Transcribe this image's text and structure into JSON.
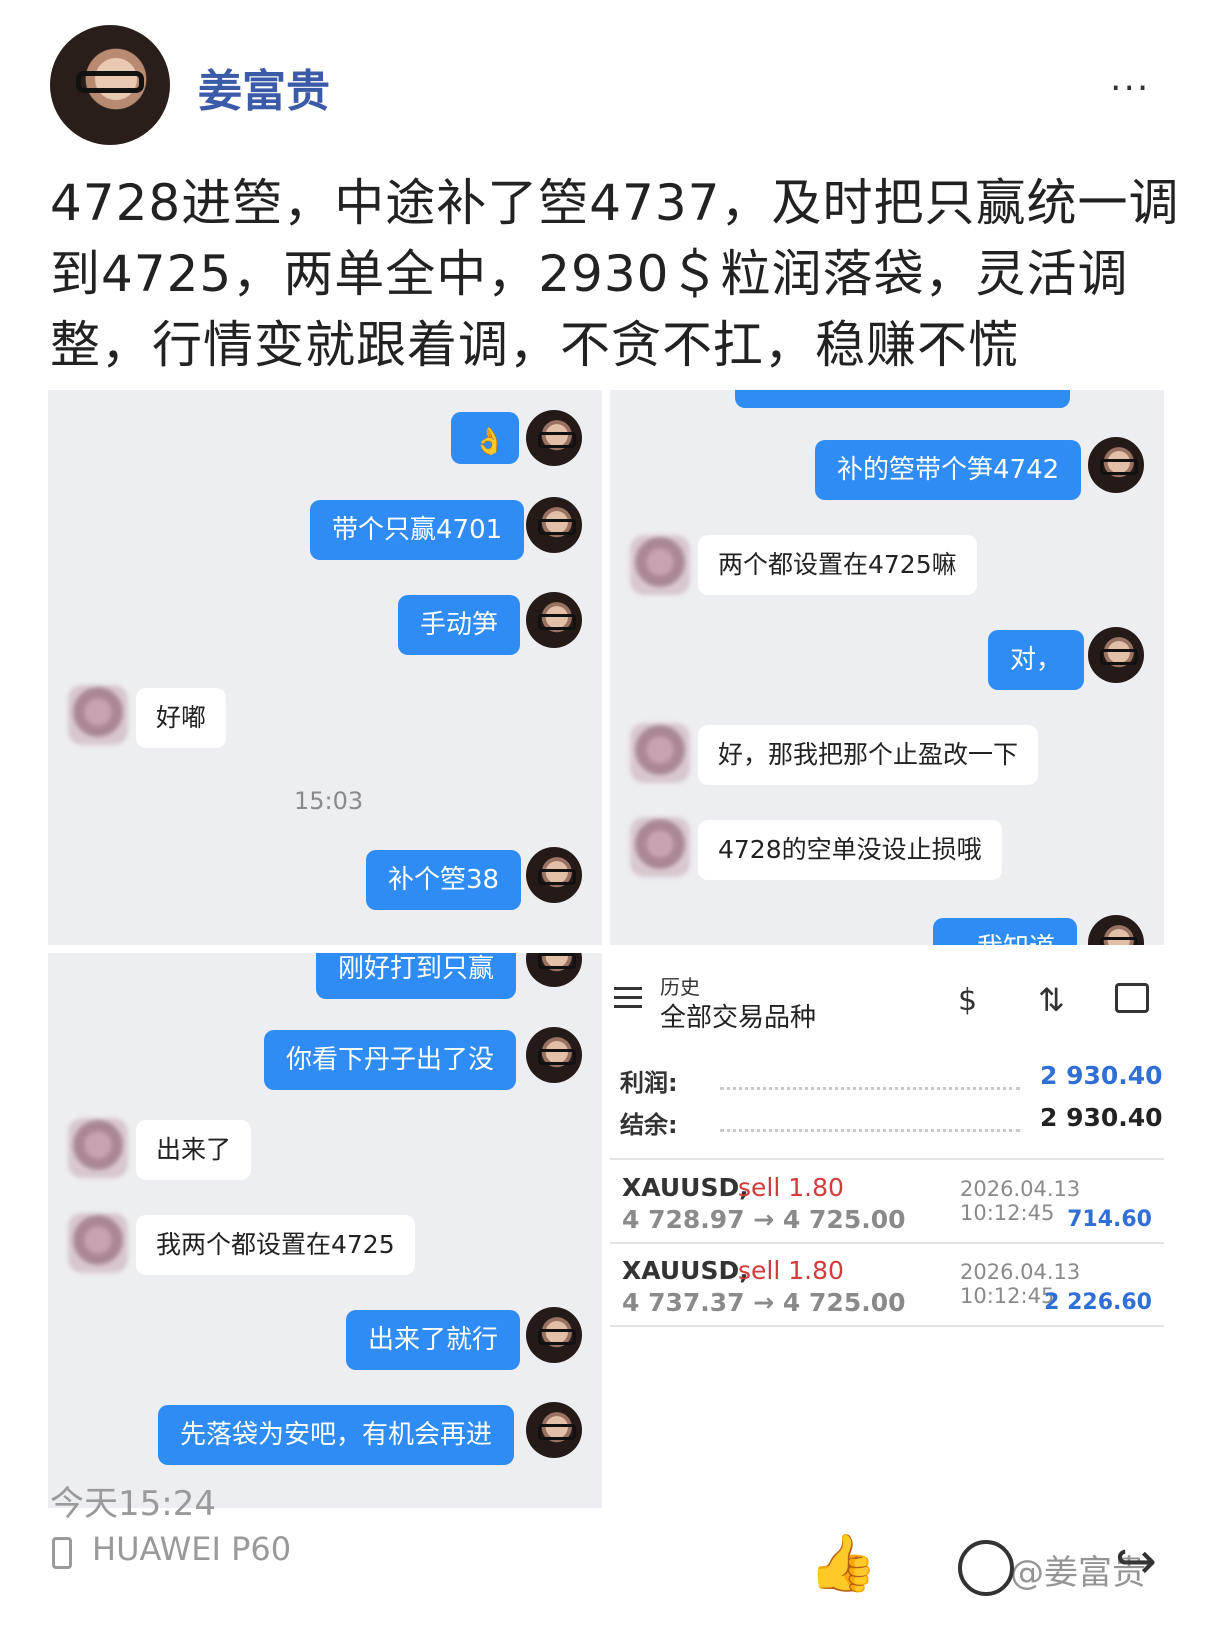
{
  "header": {
    "username": "姜富贵",
    "more_label": "···",
    "post_text": "4728进箜，中途补了箜4737，及时把只赢统一调到4725，两单全中，2930＄粒润落袋，灵活调整，行情变就跟着调，不贪不扛，稳赚不慌"
  },
  "chat1": {
    "msgs": [
      "带个只赢4701",
      "手动笋",
      "好嘟",
      "补个箜38"
    ],
    "time": "15:03"
  },
  "chat2": {
    "msgs": [
      "补的箜带个笋4742",
      "两个都设置在4725嘛",
      "对，",
      "好，那我把那个止盈改一下",
      "4728的空单没设止损哦",
      "我知道"
    ]
  },
  "chat3": {
    "msgs": [
      "刚好打到只赢",
      "你看下丹子出了没",
      "出来了",
      "我两个都设置在4725",
      "出来了就行",
      "先落袋为安吧，有机会再进"
    ]
  },
  "trade": {
    "subtitle": "历史",
    "title": "全部交易品种",
    "profit_label": "利润:",
    "profit_value": "2 930.40",
    "balance_label": "结余:",
    "balance_value": "2 930.40",
    "rows": [
      {
        "symbol": "XAUUSD,",
        "side": "sell 1.80",
        "prices": "4 728.97 → 4 725.00",
        "datetime": "2026.04.13 10:12:45",
        "profit": "714.60"
      },
      {
        "symbol": "XAUUSD,",
        "side": "sell 1.80",
        "prices": "4 737.37 → 4 725.00",
        "datetime": "2026.04.13 10:12:45",
        "profit": "2 226.60"
      }
    ]
  },
  "footer": {
    "time": "今天15:24",
    "device": "HUAWEI P60",
    "watermark": "@姜富贵"
  },
  "colors": {
    "bubble": "#2f8cf5",
    "name": "#3b5ba8",
    "profit": "#2f6fd6",
    "sell": "#d23b3b"
  }
}
